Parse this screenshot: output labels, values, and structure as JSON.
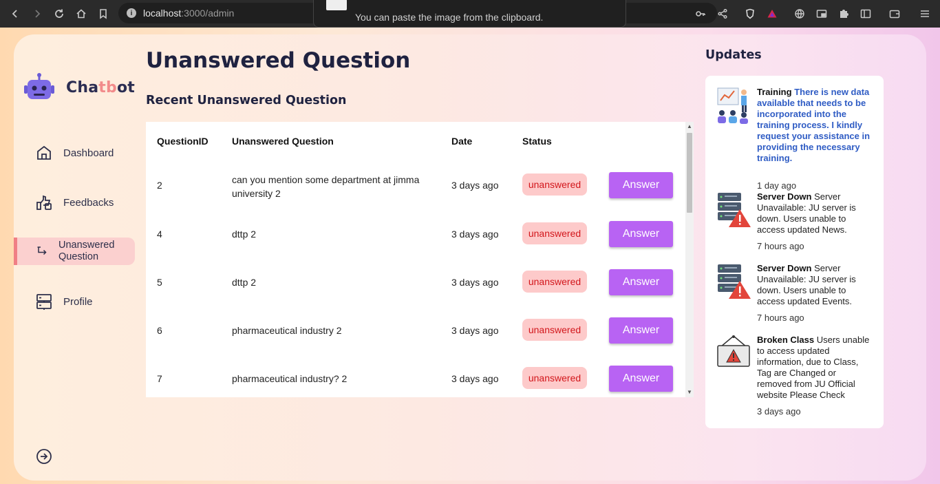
{
  "browser": {
    "url_host": "localhost",
    "url_path": ":3000/admin",
    "toast_text": "You can paste the image from the clipboard."
  },
  "brand": {
    "name_part1": "Cha",
    "name_accent": "tb",
    "name_part2": "ot"
  },
  "sidebar": {
    "items": [
      {
        "label": "Dashboard",
        "icon": "home-icon"
      },
      {
        "label": "Feedbacks",
        "icon": "feedback-icon"
      },
      {
        "label": "Unanswered Question",
        "icon": "question-icon",
        "active": true
      },
      {
        "label": "Profile",
        "icon": "profile-icon"
      }
    ]
  },
  "main": {
    "title": "Unanswered Question",
    "section_title": "Recent Unanswered Question",
    "columns": [
      "QuestionID",
      "Unanswered Question",
      "Date",
      "Status"
    ],
    "rows": [
      {
        "id": "2",
        "question": "can you mention some department at jimma university 2",
        "date": "3 days ago",
        "status": "unanswered",
        "action": "Answer"
      },
      {
        "id": "4",
        "question": "dttp 2",
        "date": "3 days ago",
        "status": "unanswered",
        "action": "Answer"
      },
      {
        "id": "5",
        "question": "dttp 2",
        "date": "3 days ago",
        "status": "unanswered",
        "action": "Answer"
      },
      {
        "id": "6",
        "question": "pharmaceutical industry 2",
        "date": "3 days ago",
        "status": "unanswered",
        "action": "Answer"
      },
      {
        "id": "7",
        "question": "pharmaceutical industry? 2",
        "date": "3 days ago",
        "status": "unanswered",
        "action": "Answer"
      }
    ]
  },
  "updates": {
    "title": "Updates",
    "items": [
      {
        "heading": "Training",
        "body": "There is new data available that needs to be incorporated into the training process. I kindly request your assistance in providing the necessary training.",
        "time": "1 day ago",
        "icon": "training-icon"
      },
      {
        "heading": "Server Down",
        "body": "Server Unavailable: JU server is down. Users unable to access updated News.",
        "time": "7 hours ago",
        "icon": "server-warning-icon"
      },
      {
        "heading": "Server Down",
        "body": "Server Unavailable: JU server is down. Users unable to access updated Events.",
        "time": "7 hours ago",
        "icon": "server-warning-icon"
      },
      {
        "heading": "Broken Class",
        "body": "Users unable to access updated information, due to Class, Tag are Changed or removed from JU Official website Please Check",
        "time": "3 days ago",
        "icon": "broken-sign-icon"
      }
    ]
  },
  "colors": {
    "accent": "#b863f3",
    "active_nav_bg": "#fbd0cf",
    "badge_bg": "#fdcaca",
    "badge_text": "#d2161b",
    "brand_accent": "#f28b8b"
  }
}
